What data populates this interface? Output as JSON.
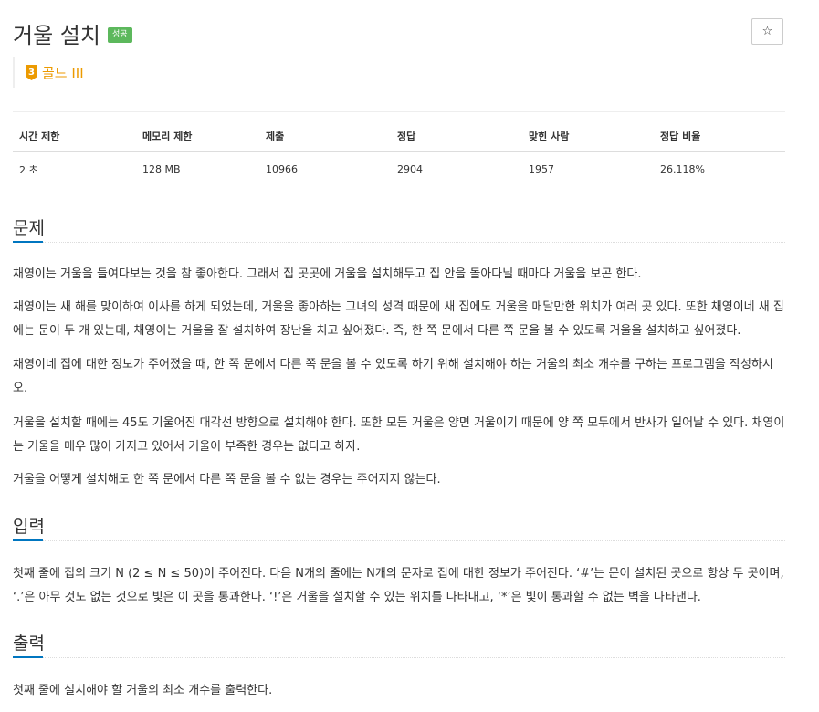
{
  "header": {
    "title": "거울 설치",
    "result_badge": "성공",
    "star_icon": "☆",
    "tier_icon": "gold-3-tier-icon",
    "tier_number": "3",
    "tier_label": "골드 III",
    "colors": {
      "badge": "#5cb85c",
      "tier": "#ec9a00",
      "section_underline": "#0076c0"
    }
  },
  "info_table": {
    "columns": [
      "시간 제한",
      "메모리 제한",
      "제출",
      "정답",
      "맞힌 사람",
      "정답 비율"
    ],
    "values": [
      "2 초",
      "128 MB",
      "10966",
      "2904",
      "1957",
      "26.118%"
    ]
  },
  "sections": {
    "problem": {
      "title": "문제",
      "paragraphs": [
        "채영이는 거울을 들여다보는 것을 참 좋아한다. 그래서 집 곳곳에 거울을 설치해두고 집 안을 돌아다닐 때마다 거울을 보곤 한다.",
        "채영이는 새 해를 맞이하여 이사를 하게 되었는데, 거울을 좋아하는 그녀의 성격 때문에 새 집에도 거울을 매달만한 위치가 여러 곳 있다. 또한 채영이네 새 집에는 문이 두 개 있는데, 채영이는 거울을 잘 설치하여 장난을 치고 싶어졌다. 즉, 한 쪽 문에서 다른 쪽 문을 볼 수 있도록 거울을 설치하고 싶어졌다.",
        "채영이네 집에 대한 정보가 주어졌을 때, 한 쪽 문에서 다른 쪽 문을 볼 수 있도록 하기 위해 설치해야 하는 거울의 최소 개수를 구하는 프로그램을 작성하시오.",
        "거울을 설치할 때에는 45도 기울어진 대각선 방향으로 설치해야 한다. 또한 모든 거울은 양면 거울이기 때문에 양 쪽 모두에서 반사가 일어날 수 있다. 채영이는 거울을 매우 많이 가지고 있어서 거울이 부족한 경우는 없다고 하자.",
        "거울을 어떻게 설치해도 한 쪽 문에서 다른 쪽 문을 볼 수 없는 경우는 주어지지 않는다."
      ]
    },
    "input": {
      "title": "입력",
      "paragraphs": [
        "첫째 줄에 집의 크기 N (2 ≤ N ≤ 50)이 주어진다. 다음 N개의 줄에는 N개의 문자로 집에 대한 정보가 주어진다. ‘#’는 문이 설치된 곳으로 항상 두 곳이며, ‘.’은 아무 것도 없는 것으로 빛은 이 곳을 통과한다. ‘!’은 거울을 설치할 수 있는 위치를 나타내고, ‘*’은 빛이 통과할 수 없는 벽을 나타낸다."
      ]
    },
    "output": {
      "title": "출력",
      "paragraphs": [
        "첫째 줄에 설치해야 할 거울의 최소 개수를 출력한다."
      ]
    }
  }
}
